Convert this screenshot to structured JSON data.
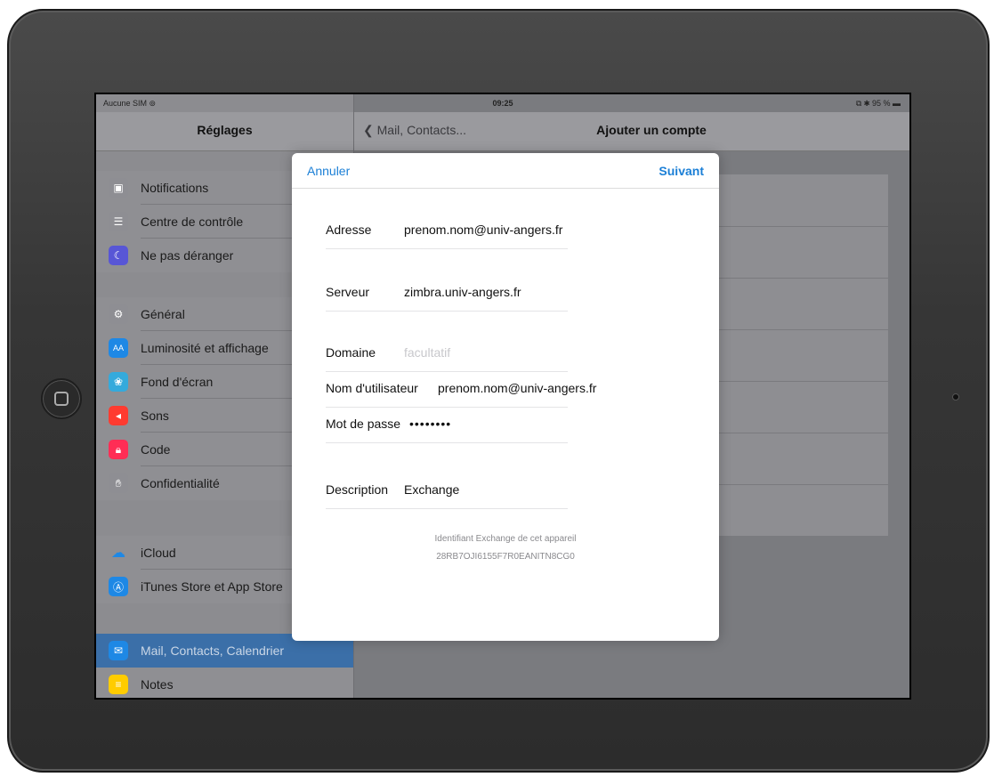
{
  "status": {
    "carrier": "Aucune SIM",
    "time": "09:25",
    "battery": "95 %"
  },
  "sidebar": {
    "title": "Réglages",
    "groups": [
      [
        {
          "label": "Notifications",
          "icon": "notifications-icon",
          "color": "#8e8e93"
        },
        {
          "label": "Centre de contrôle",
          "icon": "control-center-icon",
          "color": "#8e8e93"
        },
        {
          "label": "Ne pas déranger",
          "icon": "moon-icon",
          "color": "#5856d6"
        }
      ],
      [
        {
          "label": "Général",
          "icon": "gear-icon",
          "color": "#8e8e93"
        },
        {
          "label": "Luminosité et affichage",
          "icon": "brightness-icon",
          "color": "#1e88e5"
        },
        {
          "label": "Fond d'écran",
          "icon": "wallpaper-icon",
          "color": "#34aadc"
        },
        {
          "label": "Sons",
          "icon": "speaker-icon",
          "color": "#ff3b30"
        },
        {
          "label": "Code",
          "icon": "lock-icon",
          "color": "#ff2d55"
        },
        {
          "label": "Confidentialité",
          "icon": "hand-icon",
          "color": "#8e8e93"
        }
      ],
      [
        {
          "label": "iCloud",
          "icon": "cloud-icon",
          "color": "#ffffff"
        },
        {
          "label": "iTunes Store et App Store",
          "icon": "app-store-icon",
          "color": "#1e88e5"
        }
      ],
      [
        {
          "label": "Mail, Contacts, Calendrier",
          "icon": "mail-icon",
          "color": "#1e88e5",
          "active": true
        },
        {
          "label": "Notes",
          "icon": "notes-icon",
          "color": "#ffcc00"
        }
      ]
    ]
  },
  "detail": {
    "back_label": "Mail, Contacts...",
    "title": "Ajouter un compte"
  },
  "modal": {
    "cancel_label": "Annuler",
    "next_label": "Suivant",
    "fields": {
      "email": {
        "label": "Adresse",
        "value": "prenom.nom@univ-angers.fr"
      },
      "server": {
        "label": "Serveur",
        "value": "zimbra.univ-angers.fr"
      },
      "domain": {
        "label": "Domaine",
        "placeholder": "facultatif"
      },
      "username": {
        "label": "Nom d'utilisateur",
        "value": "prenom.nom@univ-angers.fr"
      },
      "password": {
        "label": "Mot de passe",
        "value": "••••••••"
      },
      "description": {
        "label": "Description",
        "value": "Exchange"
      }
    },
    "device_id_label": "Identifiant Exchange de cet appareil",
    "device_id": "28RB7OJI6155F7R0EANITN8CG0"
  }
}
